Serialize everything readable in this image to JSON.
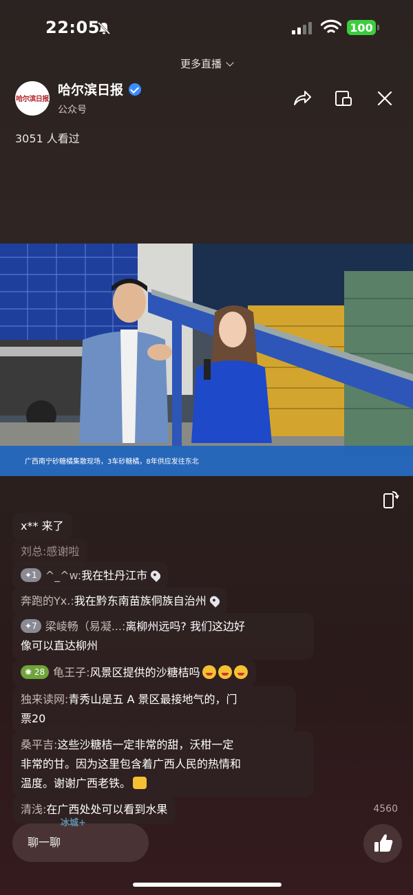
{
  "status_bar": {
    "time": "22:05",
    "battery": "100"
  },
  "header": {
    "more_live": "更多直播",
    "channel_name": "哈尔滨日报",
    "channel_type": "公众号",
    "avatar_logo": "哈尔滨日报",
    "viewers": "3051 人看过"
  },
  "video": {
    "caption": "广西南宁砂糖橘集散现场，3车砂糖橘，8年供应发往东北"
  },
  "comments": [
    {
      "user": "x**",
      "text": "来了",
      "level": ""
    },
    {
      "user": "刘总:",
      "text": "感谢啦",
      "level": ""
    },
    {
      "user": "^_^w:",
      "text": "我在牡丹江市",
      "level": "1"
    },
    {
      "user": "奔跑的Yx.:",
      "text": "我在黔东南苗族侗族自治州",
      "level": ""
    },
    {
      "user": "梁崚畅（易凝...:",
      "text": "离柳州远吗? 我们这边好",
      "text2": "像可以直达柳州",
      "level": "7"
    },
    {
      "user": "龟王子:",
      "text": "风景区提供的沙糖桔吗",
      "level": "28"
    },
    {
      "user": "独来读网:",
      "text": "青秀山是五 A 景区最接地气的，门",
      "text2": "票20",
      "level": ""
    },
    {
      "user": "桑平吉:",
      "text": "这些沙糖桔一定非常的甜，沃柑一定",
      "text2": "非常的甘。因为这里包含着广西人民的热情和",
      "text3": "温度。谢谢广西老铁。",
      "level": ""
    },
    {
      "user": "清浅:",
      "text": "在广西处处可以看到水果",
      "level": ""
    }
  ],
  "footer": {
    "input_placeholder": "聊一聊",
    "like_count": "4560",
    "watermark": "冰城+"
  }
}
